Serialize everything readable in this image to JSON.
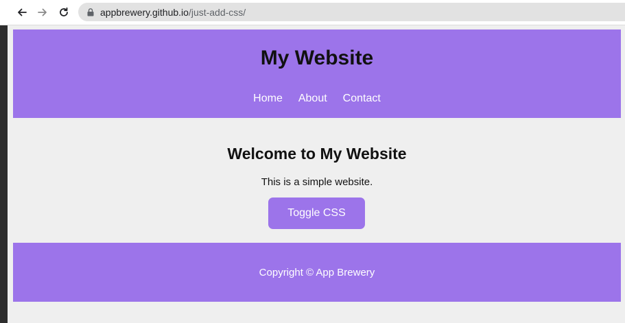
{
  "browser": {
    "url_host": "appbrewery.github.io",
    "url_path": "/just-add-css/",
    "icons": [
      "back-arrow-icon",
      "forward-arrow-icon",
      "reload-icon",
      "lock-icon"
    ]
  },
  "header": {
    "title": "My Website",
    "nav": [
      {
        "label": "Home"
      },
      {
        "label": "About"
      },
      {
        "label": "Contact"
      }
    ]
  },
  "main": {
    "heading": "Welcome to My Website",
    "text": "This is a simple website.",
    "button_label": "Toggle CSS"
  },
  "footer": {
    "copyright": "Copyright © App Brewery"
  },
  "colors": {
    "accent": "#9c74ea",
    "page_background": "#efefef"
  }
}
